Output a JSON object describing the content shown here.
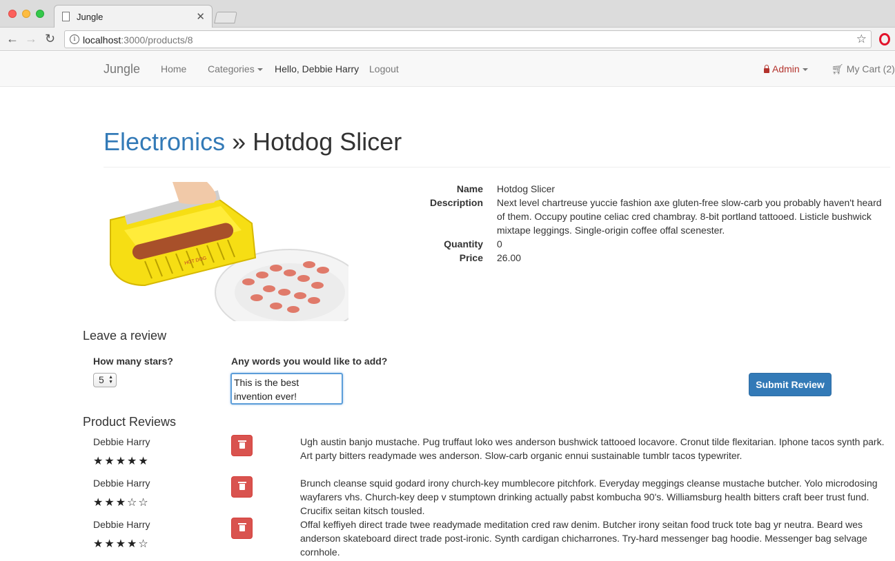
{
  "browser": {
    "tab_title": "Jungle",
    "url_host": "localhost",
    "url_rest": ":3000/products/8"
  },
  "navbar": {
    "brand": "Jungle",
    "home": "Home",
    "categories": "Categories",
    "greeting": "Hello, Debbie Harry",
    "logout": "Logout",
    "admin": "Admin",
    "cart": "My Cart (2)"
  },
  "product": {
    "category": "Electronics",
    "separator": "»",
    "title": "Hotdog Slicer",
    "labels": {
      "name": "Name",
      "description": "Description",
      "quantity": "Quantity",
      "price": "Price"
    },
    "name": "Hotdog Slicer",
    "description": "Next level chartreuse yuccie fashion axe gluten-free slow-carb you probably haven't heard of them. Occupy poutine celiac cred chambray. 8-bit portland tattooed. Listicle bushwick mixtape leggings. Single-origin coffee offal scenester.",
    "quantity": "0",
    "price": "26.00",
    "image_label": "HOT DOG"
  },
  "review_form": {
    "heading": "Leave a review",
    "stars_label": "How many stars?",
    "stars_value": "5",
    "words_label": "Any words you would like to add?",
    "words_value": "This is the best invention ever!",
    "submit_label": "Submit Review"
  },
  "reviews": {
    "heading": "Product Reviews",
    "items": [
      {
        "author": "Debbie Harry",
        "stars": "★★★★★",
        "text": "Ugh austin banjo mustache. Pug truffaut loko wes anderson bushwick tattooed locavore. Cronut tilde flexitarian. Iphone tacos synth park. Art party bitters readymade wes anderson. Slow-carb organic ennui sustainable tumblr tacos typewriter."
      },
      {
        "author": "Debbie Harry",
        "stars": "★★★☆☆",
        "text": "Brunch cleanse squid godard irony church-key mumblecore pitchfork. Everyday meggings cleanse mustache butcher. Yolo microdosing wayfarers vhs. Church-key deep v stumptown drinking actually pabst kombucha 90's. Williamsburg health bitters craft beer trust fund. Crucifix seitan kitsch tousled."
      },
      {
        "author": "Debbie Harry",
        "stars": "★★★★☆",
        "text": "Offal keffiyeh direct trade twee readymade meditation cred raw denim. Butcher irony seitan food truck tote bag yr neutra. Beard wes anderson skateboard direct trade post-ironic. Synth cardigan chicharrones. Try-hard messenger bag hoodie. Messenger bag selvage cornhole."
      }
    ]
  }
}
